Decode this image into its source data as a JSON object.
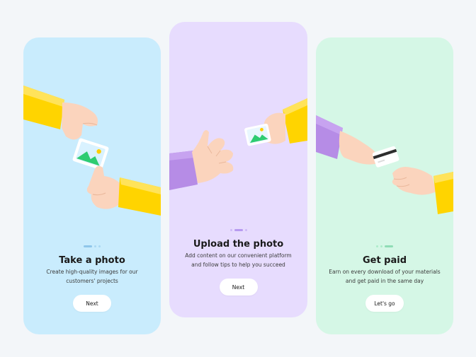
{
  "screens": [
    {
      "title": "Take a photo",
      "description_line1": "Create high-quality images for our",
      "description_line2": "customers' projects",
      "button_label": "Next",
      "active_step": 1,
      "background": "#c9ecfd",
      "dot_active_color": "#8fc6ea",
      "dot_color": "#a9d7f2"
    },
    {
      "title": "Upload the photo",
      "description_line1": "Add content on our convenient platform",
      "description_line2": "and follow tips to help you succeed",
      "button_label": "Next",
      "active_step": 2,
      "background": "#e7dcfe",
      "dot_active_color": "#b79af0",
      "dot_color": "#cdb9f7"
    },
    {
      "title": "Get paid",
      "description_line1": "Earn on every download of your materials",
      "description_line2": "and get paid in the same day",
      "button_label": "Let's go",
      "active_step": 3,
      "background": "#d5f7e6",
      "dot_active_color": "#8fdcb5",
      "dot_color": "#acebc9"
    }
  ],
  "total_steps": 3,
  "colors": {
    "skin": "#fbd4bd",
    "sleeve_yellow": "#ffd400",
    "sleeve_purple": "#b68ce6",
    "photo_green": "#2ecc71",
    "photo_sun": "#ffcc00"
  }
}
